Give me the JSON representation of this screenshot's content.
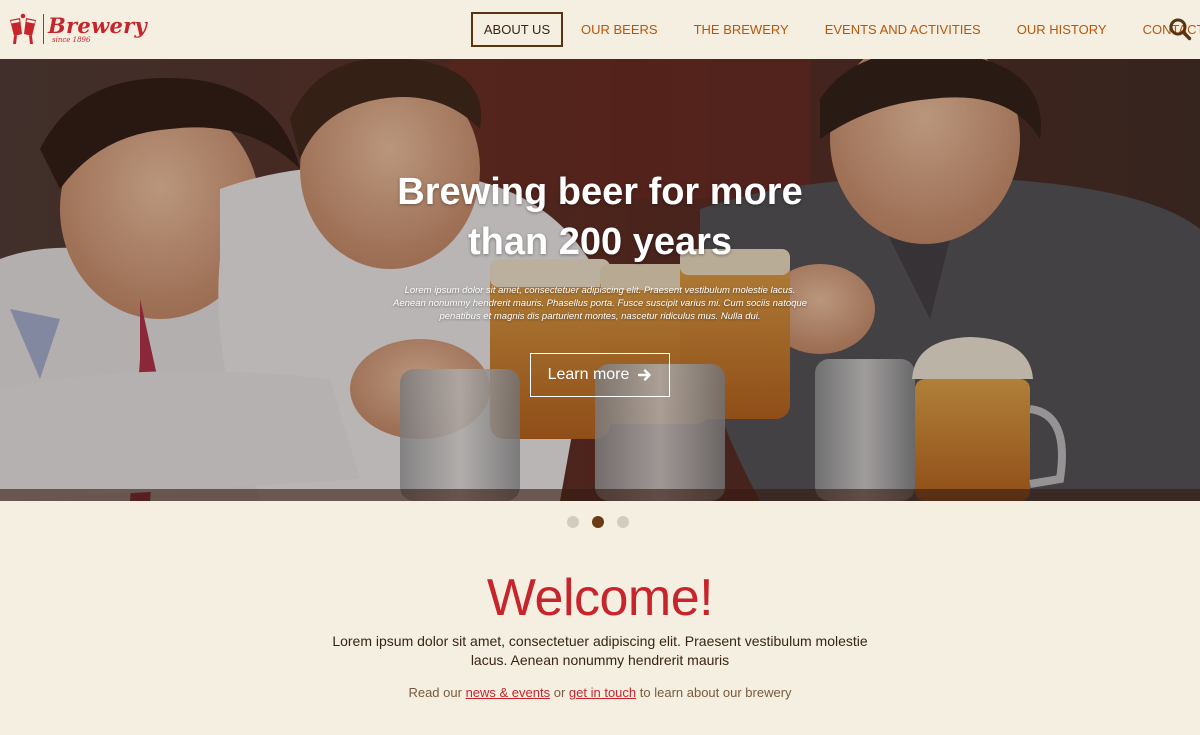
{
  "brand": {
    "name": "Brewery",
    "since": "since 1896",
    "color": "#c8242c"
  },
  "nav": {
    "items": [
      {
        "label": "ABOUT US",
        "active": true
      },
      {
        "label": "OUR BEERS",
        "active": false
      },
      {
        "label": "THE BREWERY",
        "active": false
      },
      {
        "label": "EVENTS AND ACTIVITIES",
        "active": false
      },
      {
        "label": "OUR HISTORY",
        "active": false
      },
      {
        "label": "CONTACTS",
        "active": false
      }
    ],
    "search_icon": "search-icon"
  },
  "hero": {
    "title_line1": "Brewing beer for more",
    "title_line2": "than 200 years",
    "text": "Lorem ipsum dolor sit amet, consectetuer adipiscing elit. Praesent vestibulum molestie lacus. Aenean nonummy hendrerit mauris. Phasellus porta. Fusce suscipit varius mi. Cum sociis natoque penatibus et magnis dis parturient montes, nascetur ridiculus mus. Nulla dui.",
    "button_label": "Learn more",
    "button_icon": "arrow-right-icon"
  },
  "slider": {
    "count": 3,
    "active_index": 1
  },
  "welcome": {
    "title": "Welcome!",
    "text": "Lorem ipsum dolor sit amet, consectetuer adipiscing elit. Praesent vestibulum molestie lacus. Aenean nonummy hendrerit mauris",
    "links_prefix": "Read our",
    "link1": "news & events",
    "links_middle": "or",
    "link2": "get in touch",
    "links_suffix": "to learn about our brewery"
  },
  "colors": {
    "background": "#f4efe0",
    "accent": "#c8242c",
    "nav_text": "#b8560c",
    "dark_brown": "#5a3311"
  }
}
